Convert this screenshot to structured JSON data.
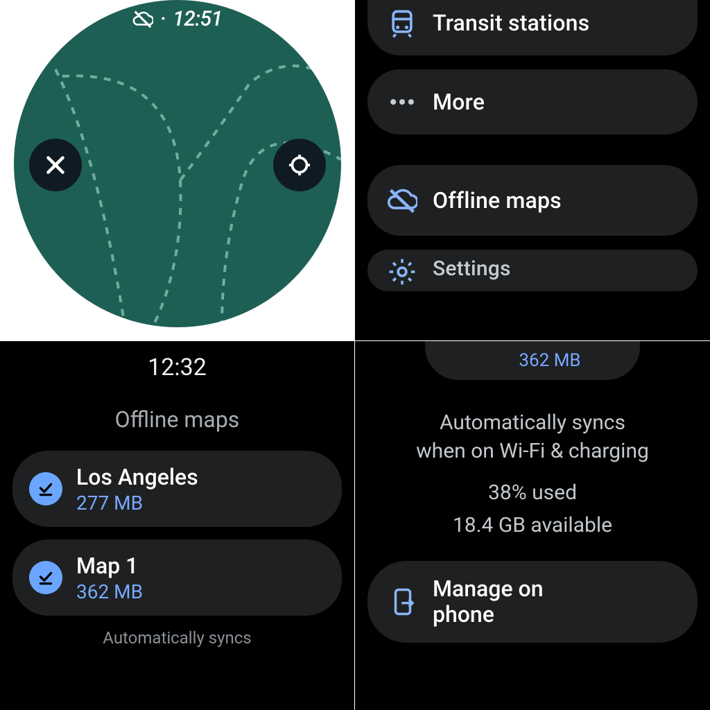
{
  "colors": {
    "accent_blue": "#7aa8ff",
    "icon_blue": "#8ab4f8",
    "chip_bg": "#1e2022",
    "map_bg": "#1e5f55"
  },
  "pane1": {
    "time": "12:51",
    "close_icon": "close-icon",
    "locate_icon": "locate-icon",
    "offline_icon": "cloud-off-icon"
  },
  "pane2": {
    "items": [
      {
        "icon": "transit-icon",
        "label": "Transit stations"
      },
      {
        "icon": "more-icon",
        "label": "More"
      },
      {
        "icon": "cloud-off-icon",
        "label": "Offline maps"
      },
      {
        "icon": "settings-icon",
        "label": "Settings"
      }
    ]
  },
  "pane3": {
    "time": "12:32",
    "title": "Offline maps",
    "maps": [
      {
        "name": "Los Angeles",
        "size": "277 MB"
      },
      {
        "name": "Map 1",
        "size": "362 MB"
      }
    ],
    "footer": "Automatically syncs"
  },
  "pane4": {
    "partial_size": "362 MB",
    "sync_line1": "Automatically syncs",
    "sync_line2": "when on Wi-Fi & charging",
    "used": "38% used",
    "available": "18.4 GB available",
    "manage_label_line1": "Manage on",
    "manage_label_line2": "phone"
  }
}
